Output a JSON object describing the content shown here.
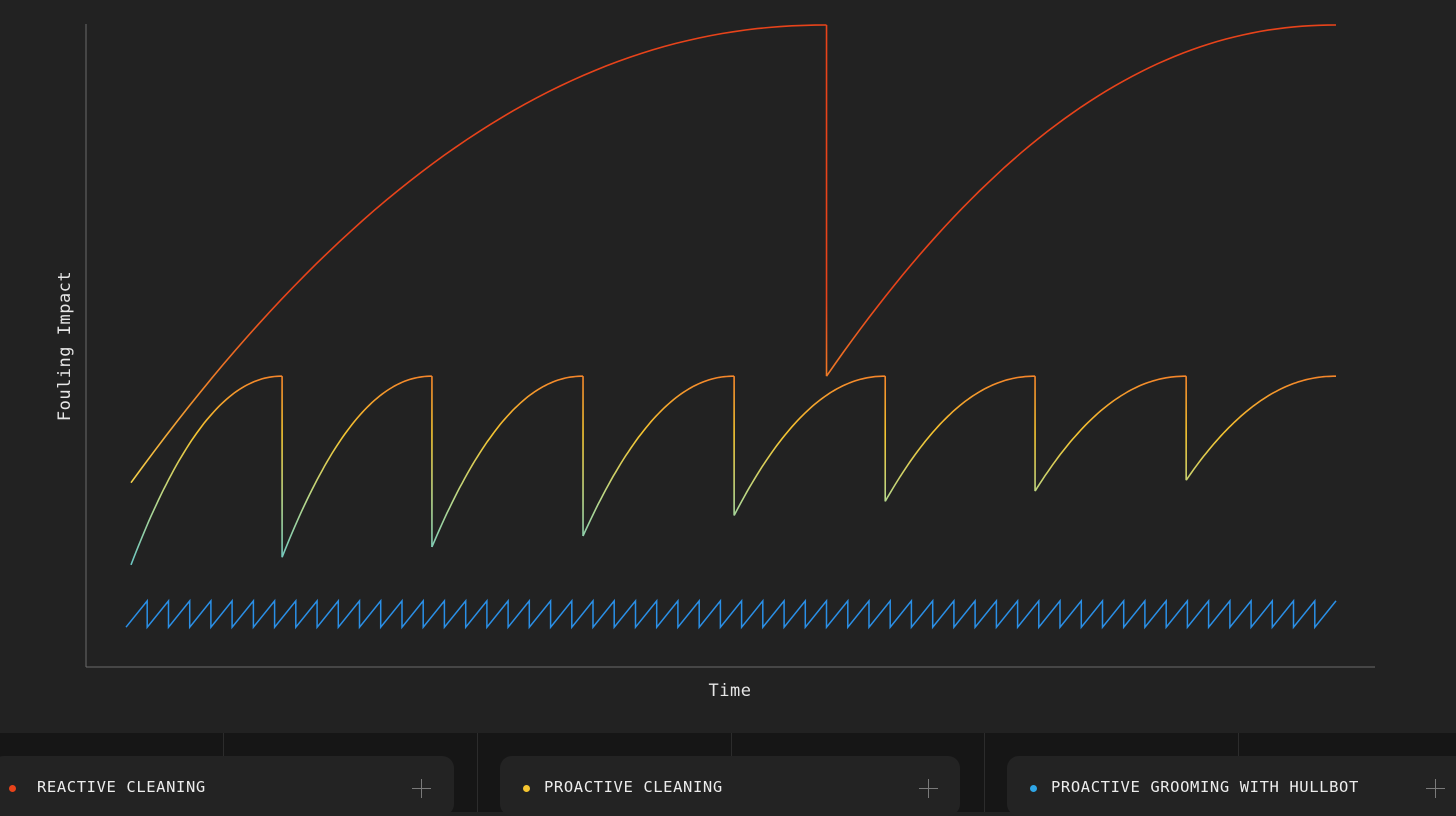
{
  "chart_data": {
    "type": "line",
    "title": "",
    "xlabel": "Time",
    "ylabel": "Fouling Impact",
    "xlim": [
      0,
      100
    ],
    "ylim": [
      0,
      100
    ],
    "grid": false,
    "ticks": false,
    "series": [
      {
        "name": "REACTIVE CLEANING",
        "color": "#e8431a",
        "shape": "sawtooth-decelerating",
        "cycles": [
          {
            "x_start": 3.5,
            "x_end": 59.2,
            "y_start": 28.7,
            "y_end": 100
          },
          {
            "x_start": 59.2,
            "x_end": 100,
            "y_start": 45.3,
            "y_end": 100
          }
        ]
      },
      {
        "name": "PROACTIVE CLEANING",
        "color": "#f5c530",
        "shape": "sawtooth-decelerating",
        "cycles": [
          {
            "x_start": 3.5,
            "x_end": 15.6,
            "y_start": 15.9,
            "y_end": 45.3
          },
          {
            "x_start": 15.6,
            "x_end": 27.6,
            "y_start": 17.1,
            "y_end": 45.3
          },
          {
            "x_start": 27.6,
            "x_end": 39.7,
            "y_start": 18.7,
            "y_end": 45.3
          },
          {
            "x_start": 39.7,
            "x_end": 51.8,
            "y_start": 20.4,
            "y_end": 45.3
          },
          {
            "x_start": 51.8,
            "x_end": 63.9,
            "y_start": 23.6,
            "y_end": 45.3
          },
          {
            "x_start": 63.9,
            "x_end": 75.9,
            "y_start": 25.8,
            "y_end": 45.3
          },
          {
            "x_start": 75.9,
            "x_end": 88.0,
            "y_start": 27.4,
            "y_end": 45.3
          },
          {
            "x_start": 88.0,
            "x_end": 100.0,
            "y_start": 29.1,
            "y_end": 45.3
          }
        ]
      },
      {
        "name": "PROACTIVE GROOMING WITH HULLBOT",
        "color": "#2a8fe6",
        "shape": "sawtooth-linear",
        "x_start": 3.1,
        "x_end": 100,
        "cycles_count": 57,
        "y_min": 6.2,
        "y_max": 10.3
      }
    ]
  },
  "legend": {
    "items": [
      {
        "label": "REACTIVE CLEANING",
        "color": "#e8431a"
      },
      {
        "label": "PROACTIVE CLEANING",
        "color": "#f5c530"
      },
      {
        "label": "PROACTIVE GROOMING WITH HULLBOT",
        "color": "#2fa6e6"
      }
    ],
    "icon": "plus-icon"
  }
}
